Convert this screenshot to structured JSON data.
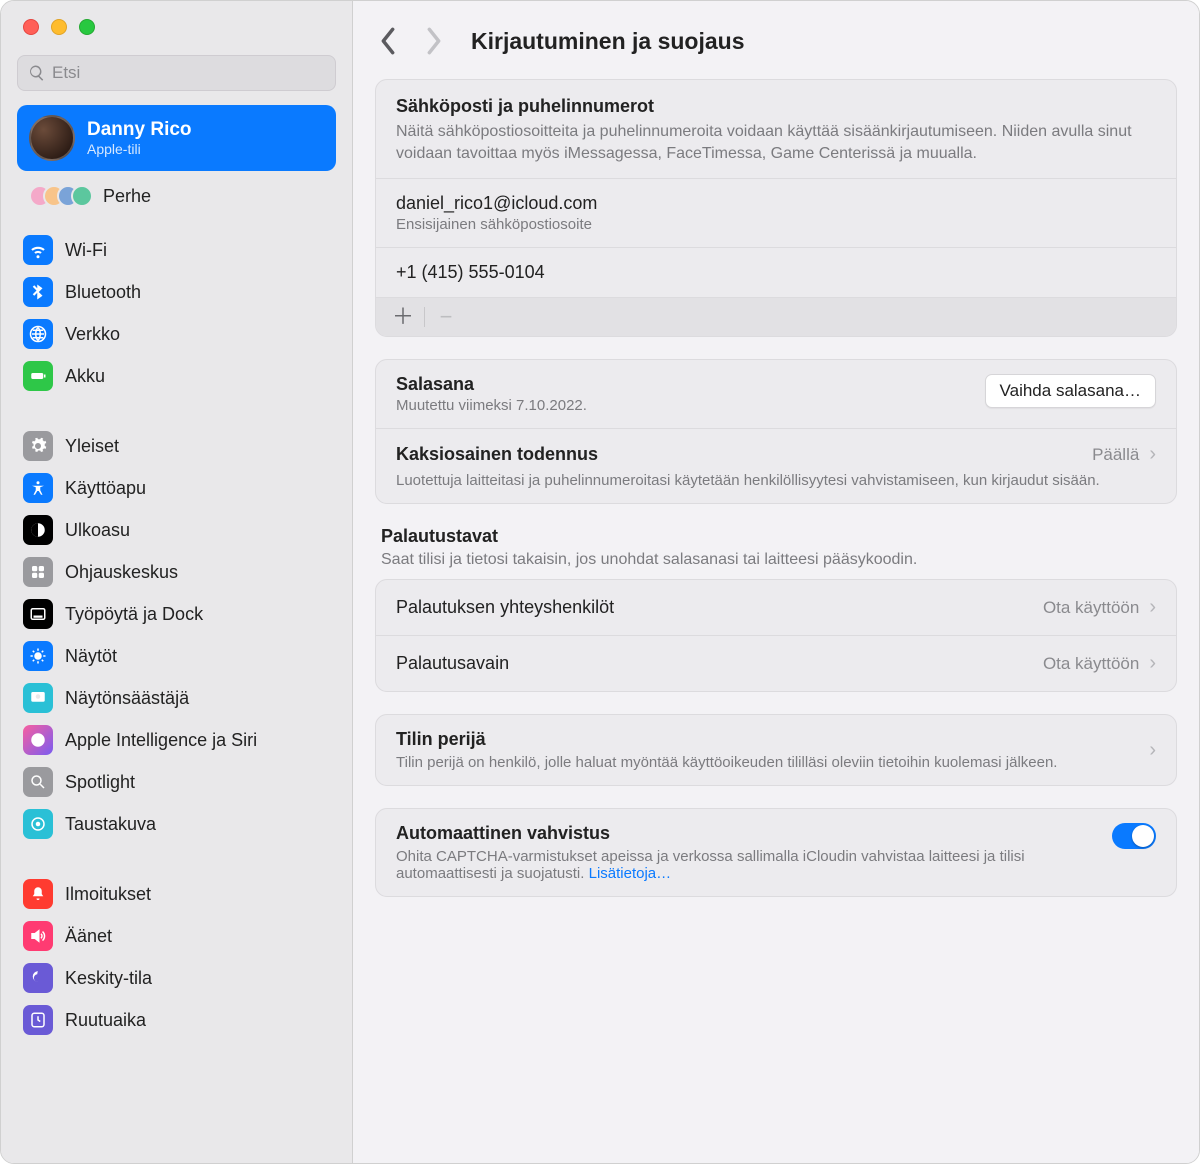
{
  "search": {
    "placeholder": "Etsi"
  },
  "account": {
    "name": "Danny Rico",
    "subtitle": "Apple-tili"
  },
  "family": {
    "label": "Perhe"
  },
  "sidebar": {
    "group1": [
      {
        "label": "Wi-Fi",
        "icon": "wifi",
        "bg": "#0a7aff"
      },
      {
        "label": "Bluetooth",
        "icon": "bluetooth",
        "bg": "#0a7aff"
      },
      {
        "label": "Verkko",
        "icon": "globe",
        "bg": "#0a7aff"
      },
      {
        "label": "Akku",
        "icon": "battery",
        "bg": "#2ec748"
      }
    ],
    "group2": [
      {
        "label": "Yleiset",
        "icon": "gear",
        "bg": "#9a9a9e"
      },
      {
        "label": "Käyttöapu",
        "icon": "accessibility",
        "bg": "#0a7aff"
      },
      {
        "label": "Ulkoasu",
        "icon": "appearance",
        "bg": "#000000"
      },
      {
        "label": "Ohjauskeskus",
        "icon": "controlcenter",
        "bg": "#9a9a9e"
      },
      {
        "label": "Työpöytä ja Dock",
        "icon": "dock",
        "bg": "#000000"
      },
      {
        "label": "Näytöt",
        "icon": "displays",
        "bg": "#0a7aff"
      },
      {
        "label": "Näytönsäästäjä",
        "icon": "screensaver",
        "bg": "#2ac0d6"
      },
      {
        "label": "Apple Intelligence ja Siri",
        "icon": "siri",
        "bg": "linear-gradient(135deg,#f85fa0,#7a5cf0)"
      },
      {
        "label": "Spotlight",
        "icon": "spotlight",
        "bg": "#9a9a9e"
      },
      {
        "label": "Taustakuva",
        "icon": "wallpaper",
        "bg": "#2ac0d6"
      }
    ],
    "group3": [
      {
        "label": "Ilmoitukset",
        "icon": "bell",
        "bg": "#ff3b30"
      },
      {
        "label": "Äänet",
        "icon": "sound",
        "bg": "#ff3b72"
      },
      {
        "label": "Keskity-tila",
        "icon": "focus",
        "bg": "#6a5ad6"
      },
      {
        "label": "Ruutuaika",
        "icon": "screentime",
        "bg": "#6a5ad6"
      }
    ]
  },
  "header": {
    "title": "Kirjautuminen ja suojaus"
  },
  "contacts": {
    "title": "Sähköposti ja puhelinnumerot",
    "desc": "Näitä sähköpostiosoitteita ja puhelinnumeroita voidaan käyttää sisäänkirjautumiseen. Niiden avulla sinut voidaan tavoittaa myös iMessagessa, FaceTimessa, Game Centerissä ja muualla.",
    "email": "daniel_rico1@icloud.com",
    "email_sub": "Ensisijainen sähköpostiosoite",
    "phone": "+1 (415) 555-0104"
  },
  "password": {
    "title": "Salasana",
    "sub": "Muutettu viimeksi 7.10.2022.",
    "button": "Vaihda salasana…"
  },
  "twofa": {
    "title": "Kaksiosainen todennus",
    "status": "Päällä",
    "desc": "Luotettuja laitteitasi ja puhelinnumeroitasi käytetään henkilöllisyytesi vahvistamiseen, kun kirjaudut sisään."
  },
  "recovery": {
    "title": "Palautustavat",
    "desc": "Saat tilisi ja tietosi takaisin, jos unohdat salasanasi tai laitteesi pääsykoodin.",
    "contacts": {
      "label": "Palautuksen yhteyshenkilöt",
      "status": "Ota käyttöön"
    },
    "key": {
      "label": "Palautusavain",
      "status": "Ota käyttöön"
    }
  },
  "legacy": {
    "title": "Tilin perijä",
    "desc": "Tilin perijä on henkilö, jolle haluat myöntää käyttöoikeuden tililläsi oleviin tietoihin kuolemasi jälkeen."
  },
  "autoverify": {
    "title": "Automaattinen vahvistus",
    "desc": "Ohita CAPTCHA-varmistukset apeissa ja verkossa sallimalla iCloudin vahvistaa laitteesi ja tilisi automaattisesti ja suojatusti. ",
    "link": "Lisätietoja…"
  }
}
